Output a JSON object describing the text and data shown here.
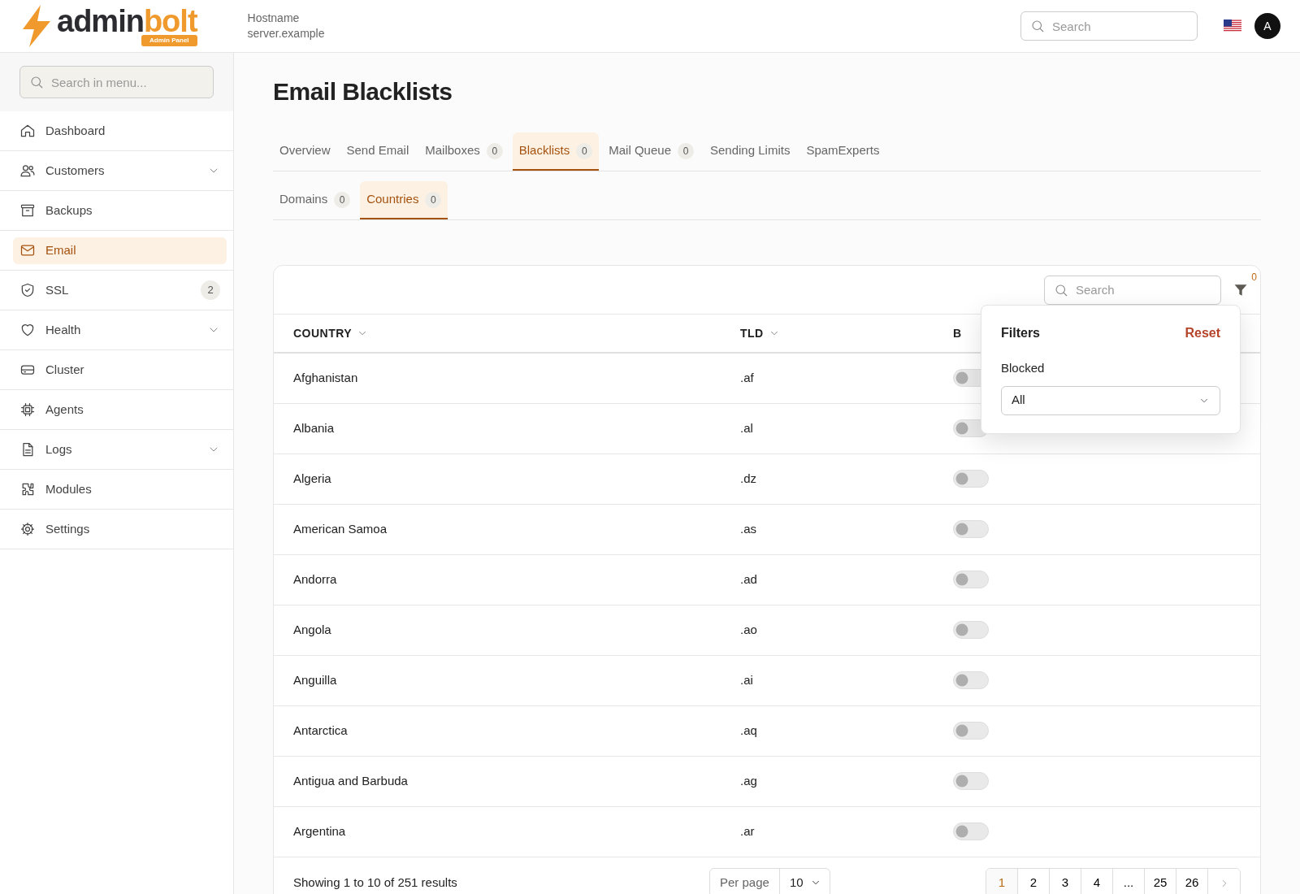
{
  "header": {
    "logo": {
      "word_dark": "admin",
      "word_accent": "bolt",
      "badge": "Admin Panel"
    },
    "hostname_label": "Hostname",
    "hostname_value": "server.example",
    "search": {
      "placeholder": "Search"
    },
    "avatar": "A"
  },
  "sidebar": {
    "search": {
      "placeholder": "Search in menu..."
    },
    "items": [
      {
        "label": "Dashboard",
        "selected": false,
        "expandable": false
      },
      {
        "label": "Customers",
        "selected": false,
        "expandable": true
      },
      {
        "label": "Backups",
        "selected": false,
        "expandable": false
      },
      {
        "label": "Email",
        "selected": true,
        "expandable": false
      },
      {
        "label": "SSL",
        "selected": false,
        "expandable": false,
        "badge": "2"
      },
      {
        "label": "Health",
        "selected": false,
        "expandable": true
      },
      {
        "label": "Cluster",
        "selected": false,
        "expandable": false
      },
      {
        "label": "Agents",
        "selected": false,
        "expandable": false
      },
      {
        "label": "Logs",
        "selected": false,
        "expandable": true
      },
      {
        "label": "Modules",
        "selected": false,
        "expandable": false
      },
      {
        "label": "Settings",
        "selected": false,
        "expandable": false
      }
    ]
  },
  "page_title": "Email Blacklists",
  "tabs": [
    {
      "label": "Overview",
      "selected": false
    },
    {
      "label": "Send Email",
      "selected": false
    },
    {
      "label": "Mailboxes",
      "selected": false,
      "count": "0"
    },
    {
      "label": "Blacklists",
      "selected": true,
      "count": "0"
    },
    {
      "label": "Mail Queue",
      "selected": false,
      "count": "0"
    },
    {
      "label": "Sending Limits",
      "selected": false
    },
    {
      "label": "SpamExperts",
      "selected": false
    }
  ],
  "subtabs": [
    {
      "label": "Domains",
      "selected": false,
      "count": "0"
    },
    {
      "label": "Countries",
      "selected": true,
      "count": "0"
    }
  ],
  "table": {
    "search": {
      "placeholder": "Search"
    },
    "filter_count": "0",
    "columns": [
      "COUNTRY",
      "TLD",
      "B"
    ],
    "rows": [
      {
        "country": "Afghanistan",
        "tld": ".af",
        "blocked": false
      },
      {
        "country": "Albania",
        "tld": ".al",
        "blocked": false
      },
      {
        "country": "Algeria",
        "tld": ".dz",
        "blocked": false
      },
      {
        "country": "American Samoa",
        "tld": ".as",
        "blocked": false
      },
      {
        "country": "Andorra",
        "tld": ".ad",
        "blocked": false
      },
      {
        "country": "Angola",
        "tld": ".ao",
        "blocked": false
      },
      {
        "country": "Anguilla",
        "tld": ".ai",
        "blocked": false
      },
      {
        "country": "Antarctica",
        "tld": ".aq",
        "blocked": false
      },
      {
        "country": "Antigua and Barbuda",
        "tld": ".ag",
        "blocked": false
      },
      {
        "country": "Argentina",
        "tld": ".ar",
        "blocked": false
      }
    ],
    "summary": "Showing 1 to 10 of 251 results",
    "per_page_label": "Per page",
    "per_page_value": "10",
    "pages": [
      {
        "label": "1",
        "selected": true
      },
      {
        "label": "2",
        "selected": false
      },
      {
        "label": "3",
        "selected": false
      },
      {
        "label": "4",
        "selected": false
      },
      {
        "label": "...",
        "selected": false
      },
      {
        "label": "25",
        "selected": false
      },
      {
        "label": "26",
        "selected": false
      }
    ]
  },
  "filters_popup": {
    "title": "Filters",
    "reset": "Reset",
    "field_label": "Blocked",
    "field_value": "All"
  }
}
